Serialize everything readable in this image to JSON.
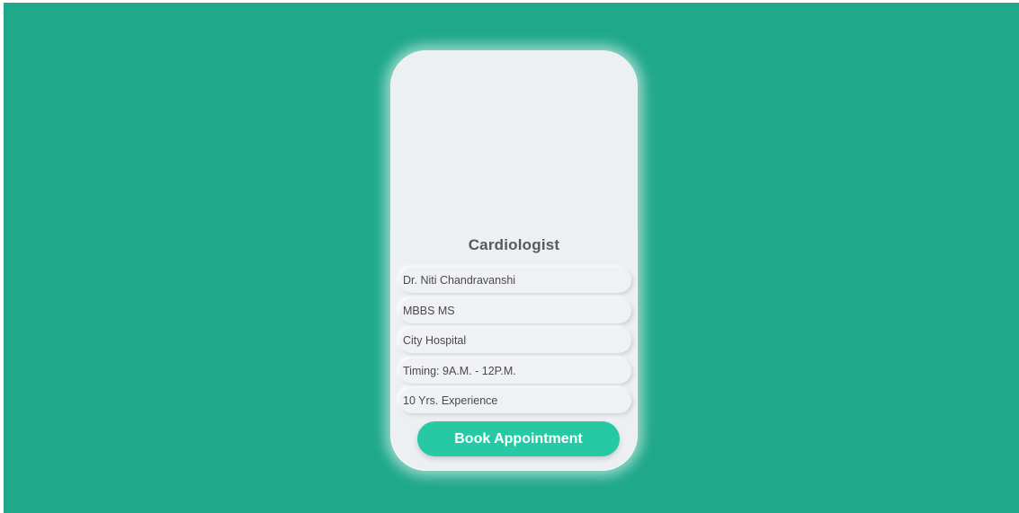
{
  "card": {
    "specialty": "Cardiologist",
    "details": [
      "Dr. Niti Chandravanshi",
      "MBBS MS",
      "City Hospital",
      "Timing: 9A.M. - 12P.M.",
      "10 Yrs. Experience"
    ],
    "book_label": "Book Appointment"
  },
  "colors": {
    "background": "#1fa88a",
    "card": "#edf0f2",
    "button": "#26c9a3"
  }
}
